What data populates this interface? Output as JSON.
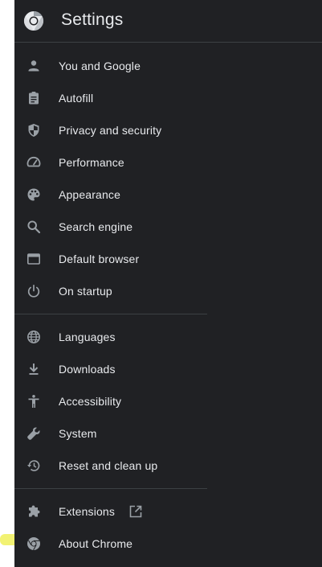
{
  "header": {
    "title": "Settings",
    "logo_icon": "chrome-logo-icon"
  },
  "colors": {
    "panel_background": "#202124",
    "text": "#e8eaed",
    "icon": "#9aa0a6",
    "divider": "#3c4043",
    "highlight": "#e8e800"
  },
  "nav": {
    "group1": [
      {
        "label": "You and Google",
        "icon": "person-icon"
      },
      {
        "label": "Autofill",
        "icon": "clipboard-icon"
      },
      {
        "label": "Privacy and security",
        "icon": "shield-icon"
      },
      {
        "label": "Performance",
        "icon": "speedometer-icon"
      },
      {
        "label": "Appearance",
        "icon": "palette-icon"
      },
      {
        "label": "Search engine",
        "icon": "search-icon"
      },
      {
        "label": "Default browser",
        "icon": "browser-window-icon"
      },
      {
        "label": "On startup",
        "icon": "power-icon"
      }
    ],
    "group2": [
      {
        "label": "Languages",
        "icon": "globe-icon"
      },
      {
        "label": "Downloads",
        "icon": "download-icon"
      },
      {
        "label": "Accessibility",
        "icon": "accessibility-icon"
      },
      {
        "label": "System",
        "icon": "wrench-icon"
      },
      {
        "label": "Reset and clean up",
        "icon": "restore-icon"
      }
    ],
    "group3": [
      {
        "label": "Extensions",
        "icon": "puzzle-icon",
        "trailing_icon": "open-in-new-icon"
      },
      {
        "label": "About Chrome",
        "icon": "chrome-logo-icon",
        "highlighted": true
      }
    ]
  }
}
